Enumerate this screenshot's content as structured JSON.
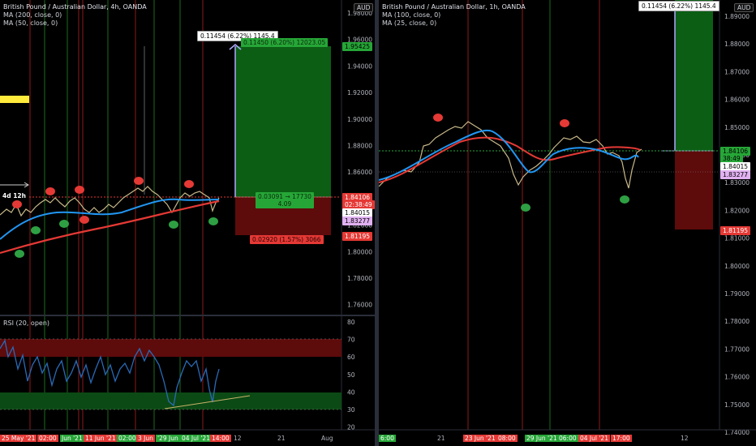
{
  "left": {
    "title": "British Pound / Australian Dollar, 4h, OANDA",
    "ma1": "MA (200, close, 0)",
    "ma2": "MA (50, close, 0)",
    "currency": "AUD",
    "price_ticks": [
      "1.98000",
      "1.96000",
      "1.94000",
      "1.92000",
      "1.90000",
      "1.88000",
      "1.86000",
      "1.84000",
      "1.82000",
      "1.80000",
      "1.78000",
      "1.76000"
    ],
    "rsi_label": "RSI (20, open)",
    "rsi_ticks": [
      "80",
      "70",
      "60",
      "50",
      "40",
      "30",
      "20"
    ],
    "time_ticks": [
      "25 May '21",
      "02:00",
      "Jun '21",
      "11 Jun '21",
      "02:00",
      "3 Jun",
      "'29 Jun '21",
      "04 Jul '21",
      "14:00",
      "12",
      "21",
      "Aug"
    ],
    "badges": {
      "target": "1.95425",
      "entry": "1.84106",
      "countdown": "02:38:49",
      "ma_a": "1.84015",
      "ma_b": "1.83277",
      "stop": "1.81195"
    },
    "position": {
      "measure": "0.11454 (6.22%) 1145.4",
      "profit": "0.11450 (6.20%) 12023.05",
      "middle_1": "0.03091 → 17730",
      "middle_2": "4.09",
      "loss": "0.02920 (1.57%) 3066"
    },
    "bar_label": "4d 12h"
  },
  "right": {
    "title": "British Pound / Australian Dollar, 1h, OANDA",
    "ma1": "MA (100, close, 0)",
    "ma2": "MA (25, close, 0)",
    "currency": "AUD",
    "price_ticks": [
      "1.89000",
      "1.88000",
      "1.87000",
      "1.86000",
      "1.85000",
      "1.84000",
      "1.83000",
      "1.82000",
      "1.81000",
      "1.80000",
      "1.79000",
      "1.78000",
      "1.77000",
      "1.76000",
      "1.75000",
      "1.74000"
    ],
    "time_ticks": [
      "6:00",
      "21",
      "23 Jun '21",
      "08:00",
      "29 Jun '21",
      "06:00",
      "04 Jul '21",
      "17:00",
      "12"
    ],
    "badges": {
      "entry": "1.84106",
      "countdown": "38:49",
      "ma_a": "1.84015",
      "ma_b": "1.83277",
      "stop": "1.81195"
    },
    "position": {
      "measure": "0.11454 (6.22%) 1145.4"
    }
  },
  "colors": {
    "ma_long": "#e53935",
    "ma_short": "#2196f3",
    "profit_fill": "#0b5e14",
    "loss_fill": "#5e0b0b",
    "green_badge": "#26a637",
    "red_badge": "#e53935"
  }
}
